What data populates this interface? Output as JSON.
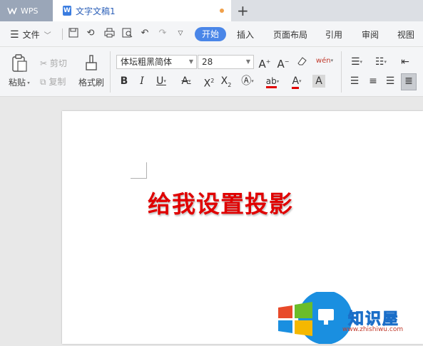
{
  "app": {
    "name": "WPS"
  },
  "tabs": [
    {
      "label": "文字文稿1",
      "unsaved": true
    }
  ],
  "menu": {
    "file_label": "文件",
    "tabs": [
      "开始",
      "插入",
      "页面布局",
      "引用",
      "审阅",
      "视图"
    ],
    "active_tab": "开始"
  },
  "ribbon": {
    "paste_label": "粘贴",
    "cut_label": "剪切",
    "copy_label": "复制",
    "format_painter_label": "格式刷",
    "font_name": "体坛粗黑简体",
    "font_size": "28",
    "pinyin_glyph": "wén"
  },
  "document": {
    "text": "给我设置投影",
    "text_color": "#e00000"
  },
  "watermark": {
    "title": "知识屋",
    "url": "www.zhishiwu.com"
  },
  "colors": {
    "accent": "#4a86e8",
    "tab_text": "#2b5fb8",
    "unsaved_dot": "#f0a04a",
    "font_color_bar": "#e00000"
  }
}
